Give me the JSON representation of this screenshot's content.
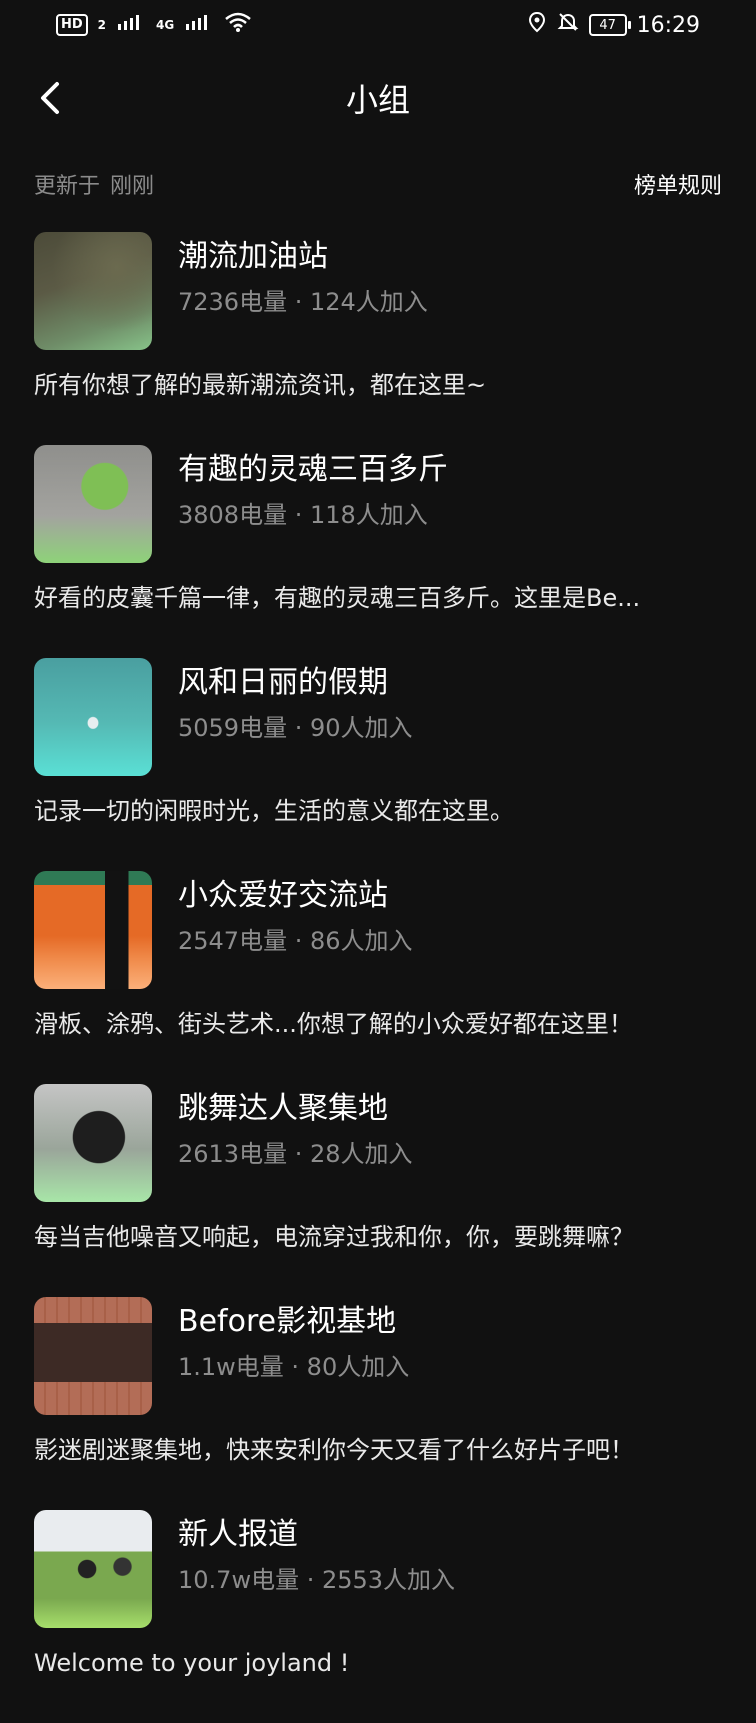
{
  "status": {
    "left_badges": [
      "HD",
      "2",
      "4G",
      "4G"
    ],
    "battery": "47",
    "time": "16:29"
  },
  "nav": {
    "title": "小组"
  },
  "meta": {
    "updated_prefix": "更新于",
    "updated_value": "刚刚",
    "rules_label": "榜单规则"
  },
  "groups": [
    {
      "name": "潮流加油站",
      "stats": "7236电量 · 124人加入",
      "desc": "所有你想了解的最新潮流资讯，都在这里~"
    },
    {
      "name": "有趣的灵魂三百多斤",
      "stats": "3808电量 · 118人加入",
      "desc": "好看的皮囊千篇一律，有趣的灵魂三百多斤。这里是Be..."
    },
    {
      "name": "风和日丽的假期",
      "stats": "5059电量 · 90人加入",
      "desc": "记录一切的闲暇时光，生活的意义都在这里。"
    },
    {
      "name": "小众爱好交流站",
      "stats": "2547电量 · 86人加入",
      "desc": "滑板、涂鸦、街头艺术...你想了解的小众爱好都在这里！"
    },
    {
      "name": "跳舞达人聚集地",
      "stats": "2613电量 · 28人加入",
      "desc": "每当吉他噪音又响起，电流穿过我和你，你，要跳舞嘛？"
    },
    {
      "name": "Before影视基地",
      "stats": "1.1w电量 · 80人加入",
      "desc": "影迷剧迷聚集地，快来安利你今天又看了什么好片子吧！"
    },
    {
      "name": "新人报道",
      "stats": "10.7w电量 · 2553人加入",
      "desc": "Welcome to your joyland !"
    }
  ]
}
